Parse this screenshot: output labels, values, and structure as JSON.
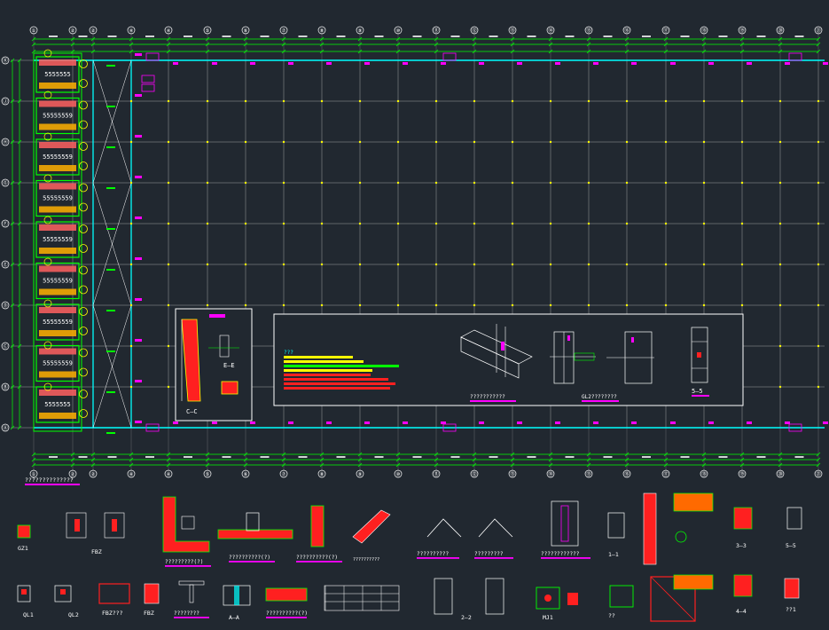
{
  "canvas": {
    "background": "#212830",
    "colors": {
      "grid": "#c8c8c8",
      "axis_line": "#00ffff",
      "dimension": "#00ff00",
      "bubble": "#ffff00",
      "node": "#ffff00",
      "annotation": "#ff00ff",
      "fill": "#ff2020",
      "text": "#ffffff"
    }
  },
  "plan": {
    "top_axis_labels": [
      "①",
      "②",
      "②",
      "④",
      "④",
      "⑤",
      "⑥",
      "⑦",
      "⑧",
      "⑨",
      "⑩",
      "⑪",
      "⑫",
      "⑬",
      "⑭",
      "⑮",
      "⑯",
      "⑰",
      "⑱",
      "⑲",
      "⑳",
      "㉑"
    ],
    "side_axis_labels": [
      "Ⓚ",
      "Ⓙ",
      "Ⓗ",
      "Ⓖ",
      "Ⓕ",
      "Ⓔ",
      "Ⓓ",
      "Ⓒ",
      "Ⓑ",
      "Ⓐ"
    ],
    "plan_title": "??????????????",
    "stair_marks": [
      "5555555",
      "55555559",
      "55555559",
      "55555559",
      "55555559",
      "55555559",
      "55555559",
      "55555559"
    ]
  },
  "details": {
    "section_cc": "C–C",
    "section_ee": "E–E",
    "box_label_1": "???????????",
    "box_label_2": "GL2????????",
    "section_55": "5—5",
    "legend_heading": "???"
  },
  "bottom": {
    "labels": [
      {
        "id": "gz1",
        "text": "GZ1"
      },
      {
        "id": "fbz",
        "text": "FBZ"
      },
      {
        "id": "ql1",
        "text": "QL1"
      },
      {
        "id": "ql2",
        "text": "QL2"
      },
      {
        "id": "fbz2",
        "text": "FBZ???"
      },
      {
        "id": "fbz3",
        "text": "FBZ"
      },
      {
        "id": "corner",
        "text": "?????????(?)"
      },
      {
        "id": "beam1",
        "text": "??????????(?)"
      },
      {
        "id": "beam2",
        "text": "??????????(?)"
      },
      {
        "id": "beam3",
        "text": "????????"
      },
      {
        "id": "beam4",
        "text": "????????"
      },
      {
        "id": "aa",
        "text": "A–A"
      },
      {
        "id": "beam5",
        "text": "??????????(?)"
      },
      {
        "id": "node1",
        "text": "??????????"
      },
      {
        "id": "node2",
        "text": "?????????"
      },
      {
        "id": "node3",
        "text": "????????????"
      },
      {
        "id": "s11",
        "text": "1—1"
      },
      {
        "id": "s22",
        "text": "2—2"
      },
      {
        "id": "s33",
        "text": "3—3"
      },
      {
        "id": "s44",
        "text": "4—4"
      },
      {
        "id": "s55b",
        "text": "5—5"
      },
      {
        "id": "mj1",
        "text": "MJ1"
      },
      {
        "id": "qq",
        "text": "??"
      },
      {
        "id": "q1",
        "text": "??1"
      },
      {
        "id": "hdr",
        "text": "??????????"
      }
    ]
  }
}
